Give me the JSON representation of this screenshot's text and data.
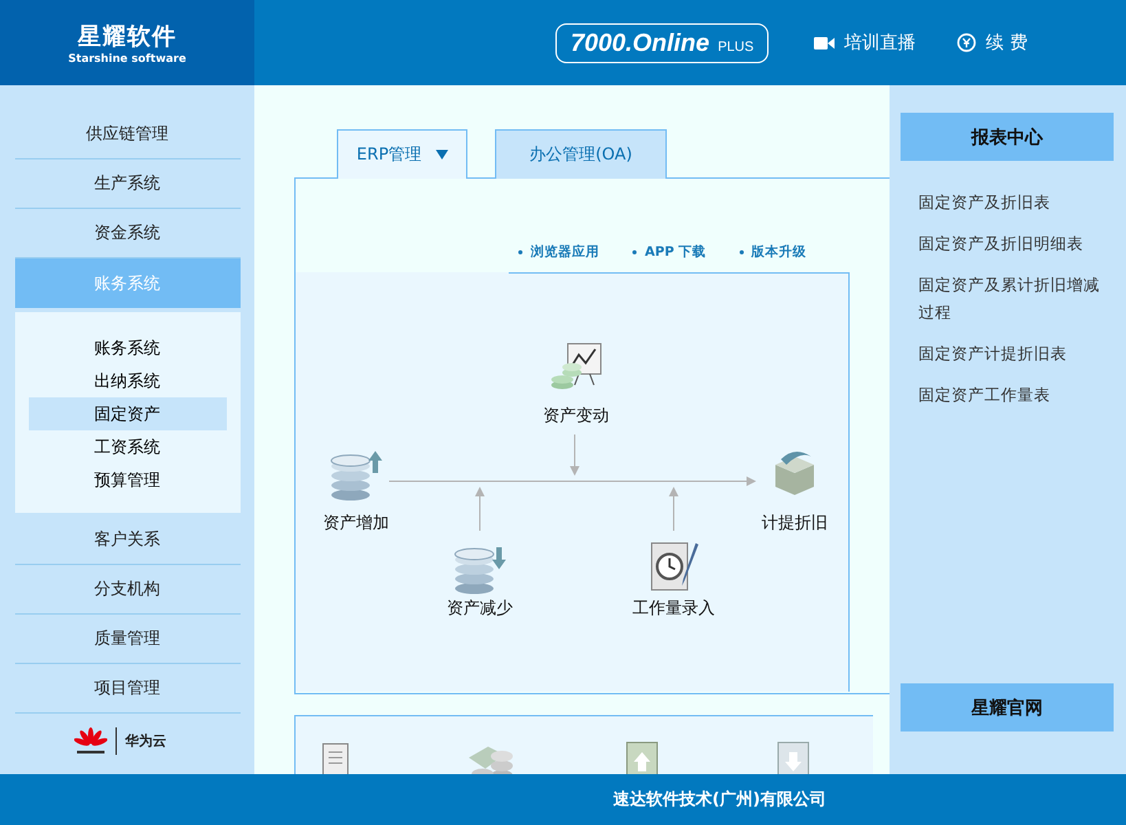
{
  "header": {
    "logo_title": "星耀软件",
    "logo_subtitle": "Starshine software",
    "product": {
      "name": "7000.Online",
      "edition": "PLUS"
    },
    "links": [
      {
        "kind": "video",
        "label": "培训直播"
      },
      {
        "kind": "renew",
        "label": "续 费"
      }
    ]
  },
  "sidebar": {
    "items": [
      {
        "label": "供应链管理",
        "selected": false
      },
      {
        "label": "生产系统",
        "selected": false
      },
      {
        "label": "资金系统",
        "selected": false
      },
      {
        "label": "账务系统",
        "selected": true,
        "children": [
          {
            "label": "账务系统",
            "selected": false
          },
          {
            "label": "出纳系统",
            "selected": false
          },
          {
            "label": "固定资产",
            "selected": true
          },
          {
            "label": "工资系统",
            "selected": false
          },
          {
            "label": "预算管理",
            "selected": false
          }
        ]
      },
      {
        "label": "客户关系",
        "selected": false
      },
      {
        "label": "分支机构",
        "selected": false
      },
      {
        "label": "质量管理",
        "selected": false
      },
      {
        "label": "项目管理",
        "selected": false
      }
    ],
    "partner": "华为云"
  },
  "tabs": [
    {
      "label": "ERP管理",
      "selected": true,
      "dropdown": true
    },
    {
      "label": "办公管理(OA)",
      "selected": false,
      "dropdown": false
    }
  ],
  "quick_links": [
    "浏览器应用",
    "APP 下载",
    "版本升级"
  ],
  "flow": {
    "nodes": [
      {
        "kind": "chart",
        "label": "资产变动"
      },
      {
        "kind": "db-up",
        "label": "资产增加"
      },
      {
        "kind": "db-down",
        "label": "资产减少"
      },
      {
        "kind": "clock",
        "label": "工作量录入"
      },
      {
        "kind": "box",
        "label": "计提折旧"
      }
    ]
  },
  "report_center": {
    "title": "报表中心",
    "reports": [
      "固定资产及折旧表",
      "固定资产及折旧明细表",
      "固定资产及累计折旧增减过程",
      "固定资产计提折旧表",
      "固定资产工作量表"
    ],
    "footer_button": "星耀官网"
  },
  "footer": {
    "company": "速达软件技术(广州)有限公司"
  }
}
